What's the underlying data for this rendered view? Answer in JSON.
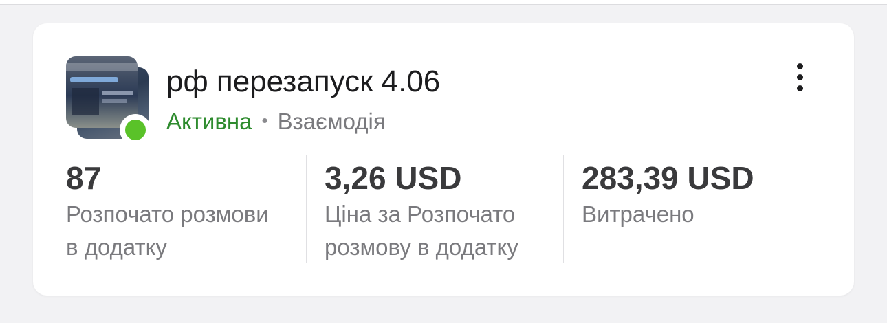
{
  "campaign": {
    "title": "рф перезапуск 4.06",
    "status": "Активна",
    "separator": "•",
    "type": "Взаємодія",
    "status_color": "#5ac229",
    "status_text_color": "#2e8b2e",
    "thumbnail_icon": "ad-thumbnail",
    "more_icon": "more-vertical-icon"
  },
  "metrics": [
    {
      "value": "87",
      "label_line1": "Розпочато розмови",
      "label_line2": "в додатку"
    },
    {
      "value": "3,26 USD",
      "label_line1": "Ціна за Розпочато",
      "label_line2": "розмову в додатку"
    },
    {
      "value": "283,39 USD",
      "label_line1": "Витрачено",
      "label_line2": ""
    }
  ]
}
